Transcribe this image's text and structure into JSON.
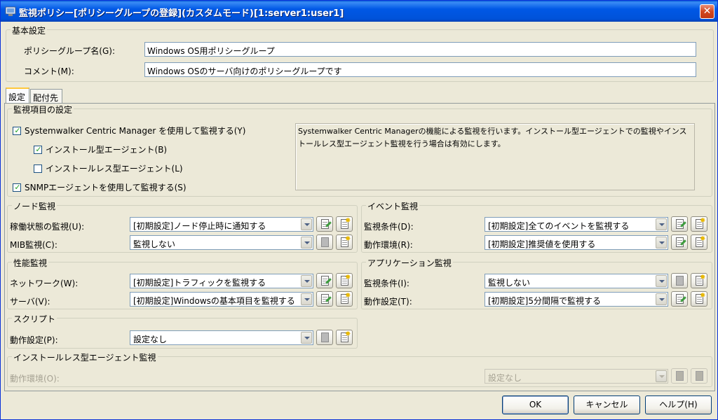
{
  "window": {
    "title": "監視ポリシー[ポリシーグループの登録](カスタムモード)[1:server1:user1]",
    "close_icon": "close-icon"
  },
  "basic": {
    "group_title": "基本設定",
    "policy_group_label": "ポリシーグループ名(G):",
    "policy_group_value": "Windows OS用ポリシーグループ",
    "comment_label": "コメント(M):",
    "comment_value": "Windows OSのサーバ向けのポリシーグループです"
  },
  "tabs": [
    {
      "label": "設定",
      "selected": true
    },
    {
      "label": "配付先",
      "selected": false
    }
  ],
  "monitoring_items": {
    "group_title": "監視項目の設定",
    "scm_label": "Systemwalker Centric Manager を使用して監視する(Y)",
    "scm_checked": true,
    "install_agent_label": "インストール型エージェント(B)",
    "install_agent_checked": true,
    "installless_agent_label": "インストールレス型エージェント(L)",
    "installless_agent_checked": false,
    "snmp_label": "SNMPエージェントを使用して監視する(S)",
    "snmp_checked": true,
    "description": "Systemwalker Centric Managerの機能による監視を行います。インストール型エージェントでの監視やインストールレス型エージェント監視を行う場合は有効にします。"
  },
  "node_monitor": {
    "group_title": "ノード監視",
    "rows": [
      {
        "label": "稼働状態の監視(U):",
        "value": "[初期設定]ノード停止時に通知する"
      },
      {
        "label": "MIB監視(C):",
        "value": "監視しない"
      }
    ]
  },
  "event_monitor": {
    "group_title": "イベント監視",
    "rows": [
      {
        "label": "監視条件(D):",
        "value": "[初期設定]全てのイベントを監視する"
      },
      {
        "label": "動作環境(R):",
        "value": "[初期設定]推奨値を使用する"
      }
    ]
  },
  "perf_monitor": {
    "group_title": "性能監視",
    "rows": [
      {
        "label": "ネットワーク(W):",
        "value": "[初期設定]トラフィックを監視する"
      },
      {
        "label": "サーバ(V):",
        "value": "[初期設定]Windowsの基本項目を監視する"
      }
    ]
  },
  "app_monitor": {
    "group_title": "アプリケーション監視",
    "rows": [
      {
        "label": "監視条件(I):",
        "value": "監視しない"
      },
      {
        "label": "動作設定(T):",
        "value": "[初期設定]5分間隔で監視する"
      }
    ]
  },
  "script": {
    "group_title": "スクリプト",
    "rows": [
      {
        "label": "動作設定(P):",
        "value": "設定なし"
      }
    ]
  },
  "installless": {
    "group_title": "インストールレス型エージェント監視",
    "rows": [
      {
        "label": "動作環境(O):",
        "value": "設定なし"
      }
    ]
  },
  "footer": {
    "ok": "OK",
    "cancel": "キャンセル",
    "help": "ヘルプ(H)"
  }
}
